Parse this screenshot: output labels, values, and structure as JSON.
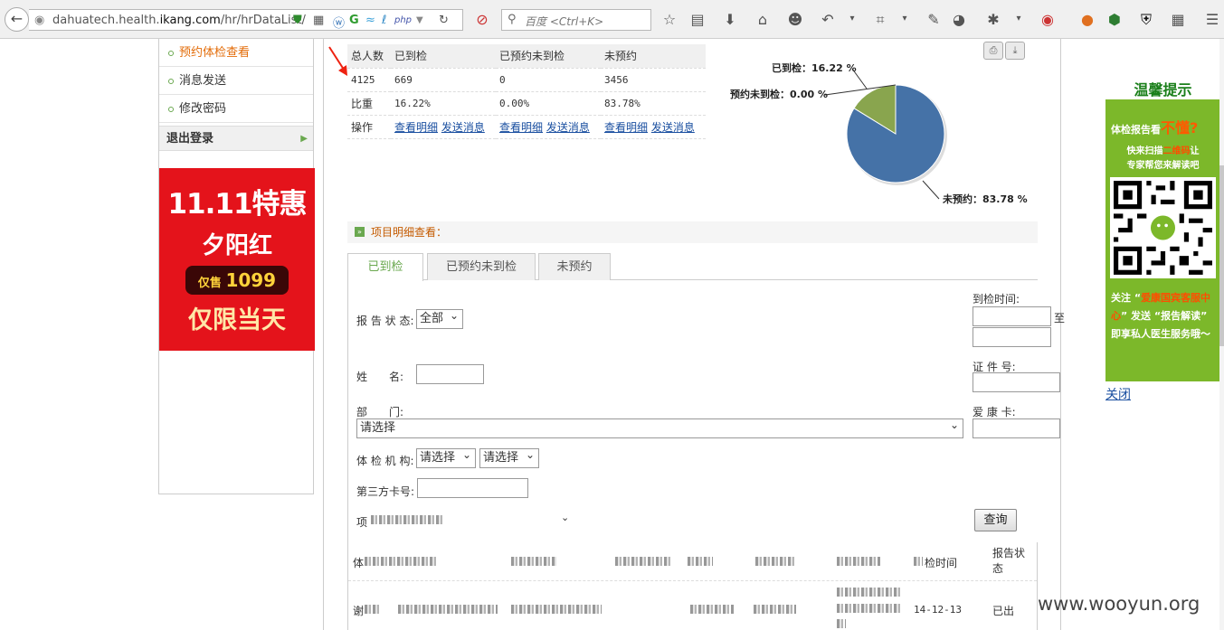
{
  "browser": {
    "url_prefix": "dahuatech.health.",
    "url_domain": "ikang.com",
    "url_path": "/hr/hrDataList/",
    "search_placeholder": "百度 <Ctrl+K>"
  },
  "sidebar": {
    "items": [
      {
        "label": "预约体检查看",
        "active": true
      },
      {
        "label": "消息发送",
        "active": false
      },
      {
        "label": "修改密码",
        "active": false
      }
    ],
    "logout": "退出登录",
    "promo": {
      "line1": "11.11特惠",
      "line2": "夕阳红",
      "price_prefix": "仅售",
      "price": "1099",
      "line4": "仅限当天"
    }
  },
  "stats": {
    "headers": [
      "总人数",
      "已到检",
      "已预约未到检",
      "未预约"
    ],
    "counts": [
      "4125",
      "669",
      "0",
      "3456"
    ],
    "ratio_label": "比重",
    "ratios": [
      "16.22%",
      "0.00%",
      "83.78%"
    ],
    "action_label": "操作",
    "view_detail": "查看明细",
    "send_msg": "发送消息"
  },
  "chart_data": {
    "type": "pie",
    "categories": [
      "已到检",
      "预约未到检",
      "未预约"
    ],
    "values": [
      16.22,
      0.0,
      83.78
    ],
    "labels": [
      "已到检：16.22 %",
      "预约未到检：0.00 %",
      "未预约：83.78 %"
    ],
    "colors": [
      "#89a54e",
      "#aa4643",
      "#4572a7"
    ]
  },
  "section": {
    "title": "项目明细查看：",
    "tabs": [
      "已到检",
      "已预约未到检",
      "未预约"
    ]
  },
  "form": {
    "report_status_label": "报 告 状 态:",
    "report_status_value": "全部",
    "arrive_time_label": "到检时间:",
    "to_label": "至",
    "name_label": "姓　　名:",
    "id_label": "证 件 号:",
    "dept_label": "部　　门:",
    "dept_value": "请选择",
    "card_label": "爱 康 卡:",
    "org_label": "体 检 机 构:",
    "org_value1": "请选择",
    "org_value2": "请选择",
    "third_card_label": "第三方卡号:",
    "item_label": "项",
    "query_button": "查询"
  },
  "results": {
    "col_first": "体",
    "col_time": "检时间",
    "col_status": "报告状态",
    "row1_first": "谢",
    "row1_date": "14-12-13",
    "row1_status": "已出"
  },
  "right_panel": {
    "title": "温馨提示",
    "line1": "体检报告看",
    "line1_emph": "不懂?",
    "line2a": "快来扫描",
    "line2_emph": "二维码",
    "line2b": "让",
    "line3": "专家帮您来解读吧",
    "line4a": "关注 “",
    "line4_emph": "爱康国宾客服中心",
    "line4b": "” 发送 “报告解读” 即享私人医生服务哦～",
    "close": "关闭"
  },
  "watermark": "www.wooyun.org"
}
